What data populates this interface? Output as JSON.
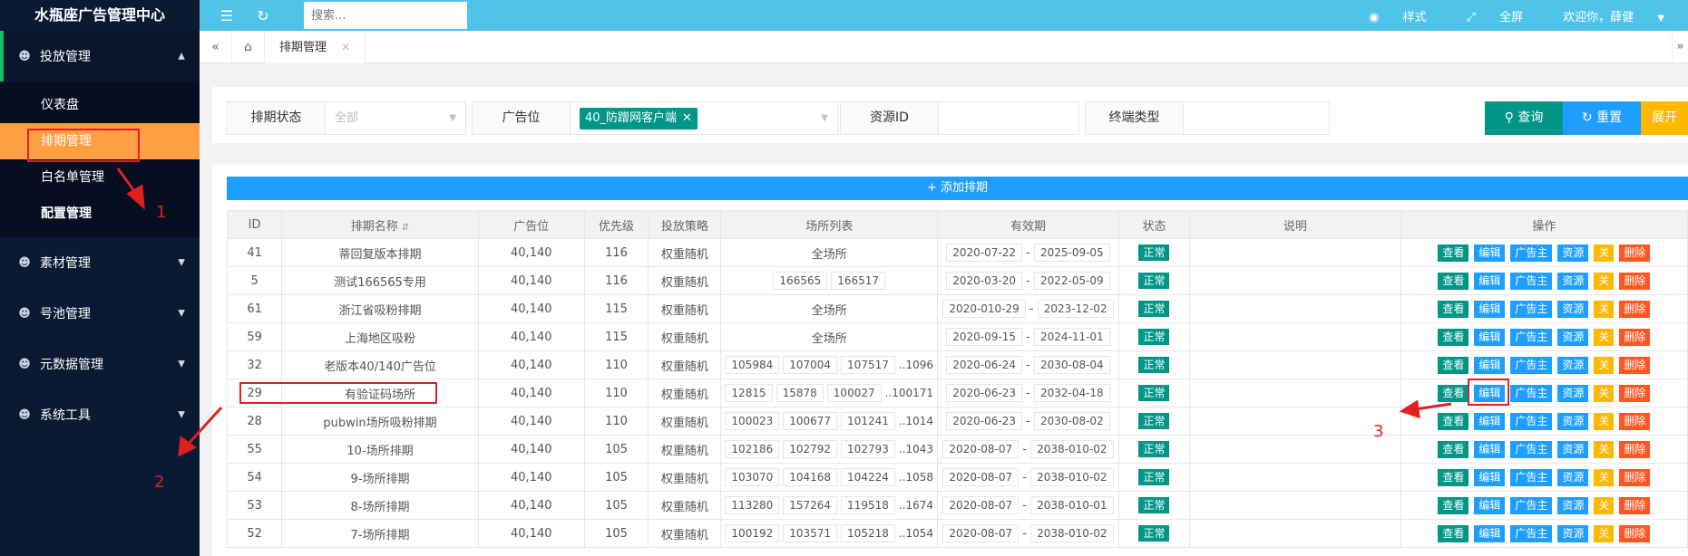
{
  "brand": "水瓶座广告管理中心",
  "sidebar": {
    "groups": [
      {
        "label": "投放管理"
      },
      {
        "label": "素材管理"
      },
      {
        "label": "号池管理"
      },
      {
        "label": "元数据管理"
      },
      {
        "label": "系统工具"
      }
    ],
    "sub_items": [
      "仪表盘",
      "排期管理",
      "白名单管理",
      "配置管理"
    ]
  },
  "header": {
    "search_placeholder": "搜索...",
    "style_label": "样式",
    "fullscreen_label": "全屏",
    "welcome": "欢迎你，薛健"
  },
  "tabs": {
    "current": "排期管理"
  },
  "filters": {
    "status_label": "排期状态",
    "status_value": "全部",
    "adpos_label": "广告位",
    "adpos_tag": "40_防蹭网客户端",
    "resource_label": "资源ID",
    "terminal_label": "终端类型",
    "query_btn": "查询",
    "reset_btn": "重置",
    "expand_btn": "展开"
  },
  "add_button": "添加排期",
  "table": {
    "headers": [
      "ID",
      "排期名称",
      "广告位",
      "优先级",
      "投放策略",
      "场所列表",
      "有效期",
      "状态",
      "说明",
      "操作"
    ],
    "rows": [
      {
        "id": "41",
        "name": "蒂回复版本排期",
        "pos": "40,140",
        "pri": "116",
        "strategy": "权重随机",
        "venues_all": "全场所",
        "start": "2020-07-22",
        "end": "2025-09-05",
        "status": "正常"
      },
      {
        "id": "5",
        "name": "测试166565专用",
        "pos": "40,140",
        "pri": "116",
        "strategy": "权重随机",
        "venues": [
          "166565",
          "166517"
        ],
        "start": "2020-03-20",
        "end": "2022-05-09",
        "status": "正常"
      },
      {
        "id": "61",
        "name": "浙江省吸粉排期",
        "pos": "40,140",
        "pri": "115",
        "strategy": "权重随机",
        "venues_all": "全场所",
        "start": "2020-010-29",
        "end": "2023-12-02",
        "status": "正常"
      },
      {
        "id": "59",
        "name": "上海地区吸粉",
        "pos": "40,140",
        "pri": "115",
        "strategy": "权重随机",
        "venues_all": "全场所",
        "start": "2020-09-15",
        "end": "2024-11-01",
        "status": "正常"
      },
      {
        "id": "32",
        "name": "老版本40/140广告位",
        "pos": "40,140",
        "pri": "110",
        "strategy": "权重随机",
        "venues": [
          "105984",
          "107004",
          "107517"
        ],
        "more": "..1096",
        "start": "2020-06-24",
        "end": "2030-08-04",
        "status": "正常"
      },
      {
        "id": "29",
        "name": "有验证码场所",
        "pos": "40,140",
        "pri": "110",
        "strategy": "权重随机",
        "venues": [
          "12815",
          "15878",
          "100027"
        ],
        "more": "..100171",
        "start": "2020-06-23",
        "end": "2032-04-18",
        "status": "正常"
      },
      {
        "id": "28",
        "name": "pubwin场所吸粉排期",
        "pos": "40,140",
        "pri": "110",
        "strategy": "权重随机",
        "venues": [
          "100023",
          "100677",
          "101241"
        ],
        "more": "..1014",
        "start": "2020-06-23",
        "end": "2030-08-02",
        "status": "正常"
      },
      {
        "id": "55",
        "name": "10-场所排期",
        "pos": "40,140",
        "pri": "105",
        "strategy": "权重随机",
        "venues": [
          "102186",
          "102792",
          "102793"
        ],
        "more": "..1043",
        "start": "2020-08-07",
        "end": "2038-010-02",
        "status": "正常"
      },
      {
        "id": "54",
        "name": "9-场所排期",
        "pos": "40,140",
        "pri": "105",
        "strategy": "权重随机",
        "venues": [
          "103070",
          "104168",
          "104224"
        ],
        "more": "..1058",
        "start": "2020-08-07",
        "end": "2038-010-02",
        "status": "正常"
      },
      {
        "id": "53",
        "name": "8-场所排期",
        "pos": "40,140",
        "pri": "105",
        "strategy": "权重随机",
        "venues": [
          "113280",
          "157264",
          "119518"
        ],
        "more": "..1674",
        "start": "2020-08-07",
        "end": "2038-010-01",
        "status": "正常"
      },
      {
        "id": "52",
        "name": "7-场所排期",
        "pos": "40,140",
        "pri": "105",
        "strategy": "权重随机",
        "venues": [
          "100192",
          "103571",
          "105218"
        ],
        "more": "..1054",
        "start": "2020-08-07",
        "end": "2038-010-02",
        "status": "正常"
      }
    ],
    "ops": [
      "查看",
      "编辑",
      "广告主",
      "资源",
      "关",
      "删除"
    ]
  },
  "annotations": [
    "1",
    "2",
    "3"
  ]
}
